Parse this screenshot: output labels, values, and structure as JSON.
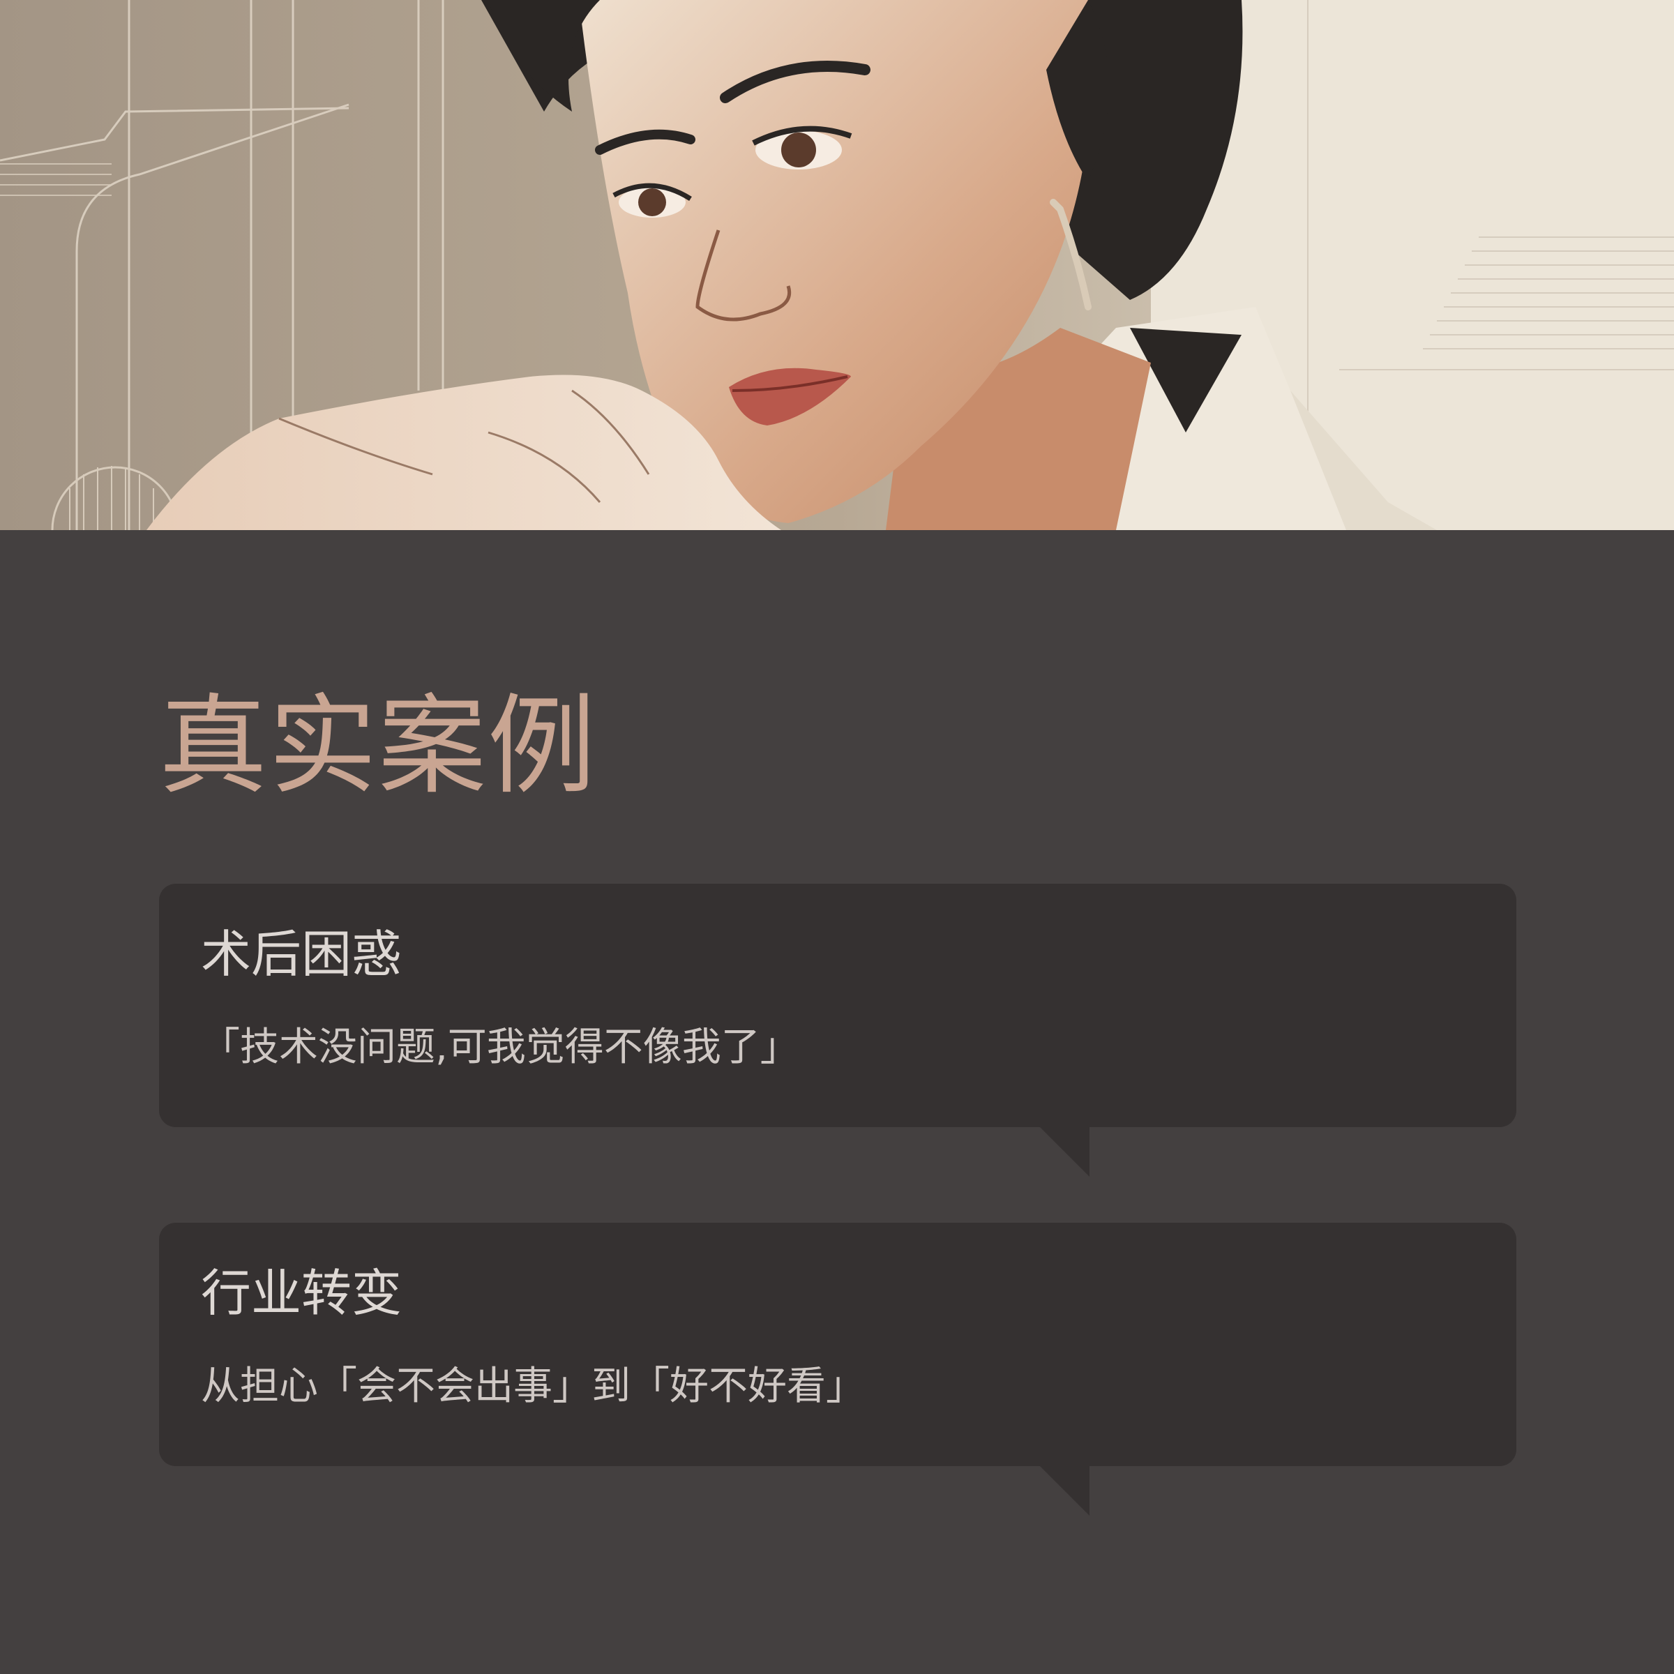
{
  "colors": {
    "background": "#444040",
    "card": "#353131",
    "title": "#c9a592",
    "card_title": "#ded8d4",
    "card_text": "#cfc8c4"
  },
  "hero": {
    "image": "illustration-woman-portrait"
  },
  "title": "真实案例",
  "cards": [
    {
      "title": "术后困惑",
      "text": "「技术没问题,可我觉得不像我了」"
    },
    {
      "title": "行业转变",
      "text": "从担心「会不会出事」到「好不好看」"
    }
  ]
}
